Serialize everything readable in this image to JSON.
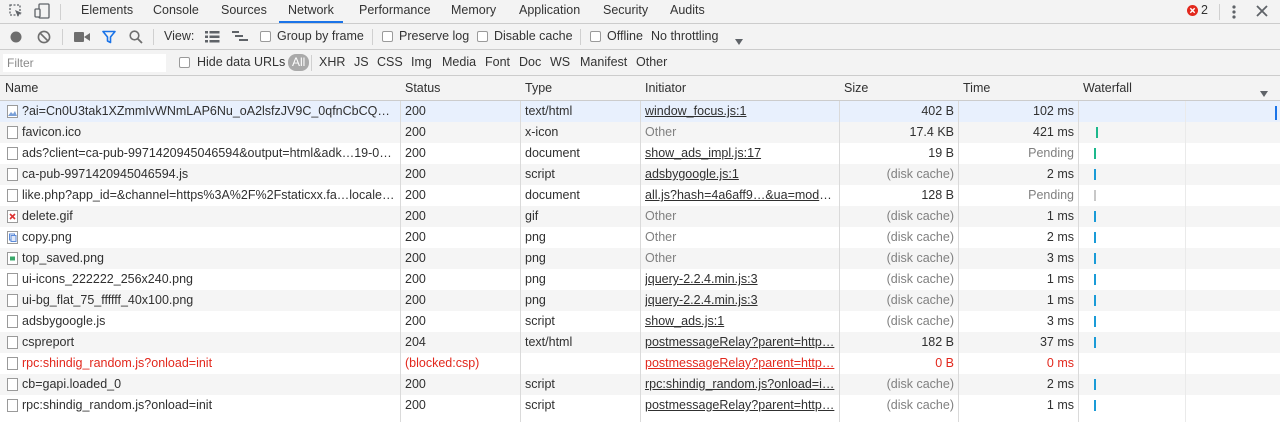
{
  "tabs": [
    "Elements",
    "Console",
    "Sources",
    "Network",
    "Performance",
    "Memory",
    "Application",
    "Security",
    "Audits"
  ],
  "active_tab": "Network",
  "error_count": "2",
  "toolbar": {
    "view_label": "View:",
    "group_by_frame": "Group by frame",
    "preserve_log": "Preserve log",
    "disable_cache": "Disable cache",
    "offline": "Offline",
    "throttling": "No throttling"
  },
  "filterbar": {
    "placeholder": "Filter",
    "hide_data_urls": "Hide data URLs",
    "types": [
      "All",
      "XHR",
      "JS",
      "CSS",
      "Img",
      "Media",
      "Font",
      "Doc",
      "WS",
      "Manifest",
      "Other"
    ]
  },
  "columns": {
    "name": "Name",
    "status": "Status",
    "type": "Type",
    "initiator": "Initiator",
    "size": "Size",
    "time": "Time",
    "waterfall": "Waterfall"
  },
  "colors": {
    "accent": "#1a73e8",
    "error": "#e2281d",
    "waterfall_blue": "#1a9bd7",
    "waterfall_green": "#1db88c"
  },
  "rows": [
    {
      "name": "?ai=Cn0U3tak1XZmmIvWNmLAP6Nu_oA2lsfzJV9C_0qfnCbCQH......",
      "status": "200",
      "type": "text/html",
      "initiator": "window_focus.js:1",
      "initiator_link": true,
      "size": "402 B",
      "time": "102 ms",
      "icon": "image-file-icon"
    },
    {
      "name": "favicon.ico",
      "status": "200",
      "type": "x-icon",
      "initiator": "Other",
      "initiator_link": false,
      "size": "17.4 KB",
      "time": "421 ms",
      "icon": "file-icon"
    },
    {
      "name": "ads?client=ca-pub-9971420945046594&output=html&adk…19-07-…",
      "status": "200",
      "type": "document",
      "initiator": "show_ads_impl.js:17",
      "initiator_link": true,
      "size": "19 B",
      "time": "Pending",
      "icon": "file-icon"
    },
    {
      "name": "ca-pub-9971420945046594.js",
      "status": "200",
      "type": "script",
      "initiator": "adsbygoogle.js:1",
      "initiator_link": true,
      "size": "(disk cache)",
      "time": "2 ms",
      "icon": "file-icon"
    },
    {
      "name": "like.php?app_id=&channel=https%3A%2F%2Fstaticxx.fa…locale=…",
      "status": "200",
      "type": "document",
      "initiator": "all.js?hash=4a6aff9…&ua=moder…",
      "initiator_link": true,
      "size": "128 B",
      "time": "Pending",
      "icon": "file-icon"
    },
    {
      "name": "delete.gif",
      "status": "200",
      "type": "gif",
      "initiator": "Other",
      "initiator_link": false,
      "size": "(disk cache)",
      "time": "1 ms",
      "icon": "delete-image-icon"
    },
    {
      "name": "copy.png",
      "status": "200",
      "type": "png",
      "initiator": "Other",
      "initiator_link": false,
      "size": "(disk cache)",
      "time": "2 ms",
      "icon": "copy-image-icon"
    },
    {
      "name": "top_saved.png",
      "status": "200",
      "type": "png",
      "initiator": "Other",
      "initiator_link": false,
      "size": "(disk cache)",
      "time": "3 ms",
      "icon": "saved-image-icon"
    },
    {
      "name": "ui-icons_222222_256x240.png",
      "status": "200",
      "type": "png",
      "initiator": "jquery-2.2.4.min.js:3",
      "initiator_link": true,
      "size": "(disk cache)",
      "time": "1 ms",
      "icon": "file-icon"
    },
    {
      "name": "ui-bg_flat_75_ffffff_40x100.png",
      "status": "200",
      "type": "png",
      "initiator": "jquery-2.2.4.min.js:3",
      "initiator_link": true,
      "size": "(disk cache)",
      "time": "1 ms",
      "icon": "file-icon"
    },
    {
      "name": "adsbygoogle.js",
      "status": "200",
      "type": "script",
      "initiator": "show_ads.js:1",
      "initiator_link": true,
      "size": "(disk cache)",
      "time": "3 ms",
      "icon": "file-icon"
    },
    {
      "name": "cspreport",
      "status": "204",
      "type": "text/html",
      "initiator": "postmessageRelay?parent=http…",
      "initiator_link": true,
      "size": "182 B",
      "time": "37 ms",
      "icon": "file-icon"
    },
    {
      "name": "rpc:shindig_random.js?onload=init",
      "status": "(blocked:csp)",
      "type": "",
      "initiator": "postmessageRelay?parent=http…",
      "initiator_link": true,
      "size": "0 B",
      "time": "0 ms",
      "icon": "file-icon",
      "error": true
    },
    {
      "name": "cb=gapi.loaded_0",
      "status": "200",
      "type": "script",
      "initiator": "rpc:shindig_random.js?onload=i…",
      "initiator_link": true,
      "size": "(disk cache)",
      "time": "2 ms",
      "icon": "file-icon"
    },
    {
      "name": "rpc:shindig_random.js?onload=init",
      "status": "200",
      "type": "script",
      "initiator": "postmessageRelay?parent=http…",
      "initiator_link": true,
      "size": "(disk cache)",
      "time": "1 ms",
      "icon": "file-icon"
    }
  ]
}
